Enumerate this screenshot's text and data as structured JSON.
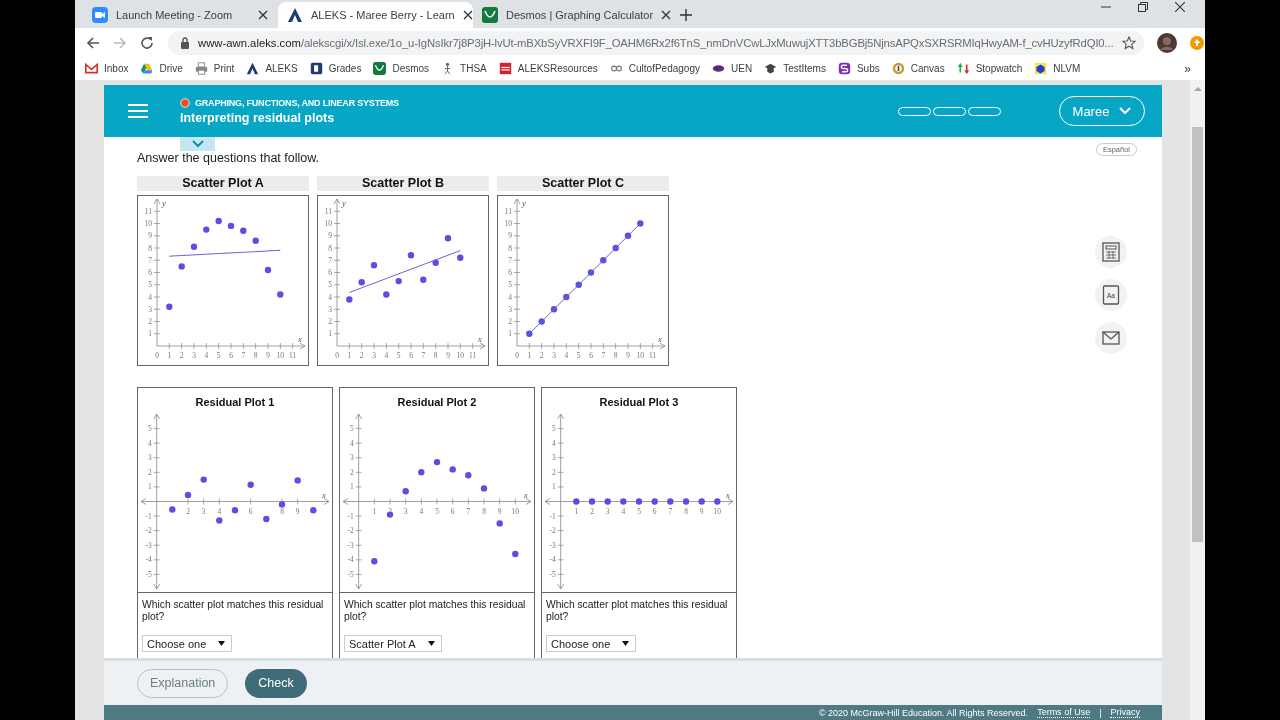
{
  "browser": {
    "tabs": [
      {
        "title": "Launch Meeting - Zoom",
        "kind": "zoom",
        "selected": false
      },
      {
        "title": "ALEKS - Maree Berry - Learn",
        "kind": "aleks",
        "selected": true
      },
      {
        "title": "Desmos | Graphing Calculator",
        "kind": "desmos",
        "selected": false
      }
    ],
    "address": {
      "host": "www-awn.aleks.com",
      "path": "/alekscgi/x/Isl.exe/1o_u-IgNsIkr7j8P3jH-lvUt-mBXbSyVRXFI9F_OAHM6Rx2f6TnS_nmDnVCwLJxMuwujXTT3bBGBj5NjnsAPQxSXRSRMIqHwyAM-f_cvHUzyfRdQI0..."
    },
    "bookmarks": [
      {
        "label": "Inbox",
        "kind": "gmail"
      },
      {
        "label": "Drive",
        "kind": "drive"
      },
      {
        "label": "Print",
        "kind": "print"
      },
      {
        "label": "ALEKS",
        "kind": "aleks"
      },
      {
        "label": "Grades",
        "kind": "grades"
      },
      {
        "label": "Desmos",
        "kind": "desmos"
      },
      {
        "label": "THSA",
        "kind": "thsa"
      },
      {
        "label": "ALEKSResources",
        "kind": "mcgraw"
      },
      {
        "label": "CultofPedagogy",
        "kind": "link"
      },
      {
        "label": "UEN",
        "kind": "uen"
      },
      {
        "label": "TestItems",
        "kind": "cap"
      },
      {
        "label": "Subs",
        "kind": "subs"
      },
      {
        "label": "Canvas",
        "kind": "canvas"
      },
      {
        "label": "Stopwatch",
        "kind": "arrows"
      },
      {
        "label": "NLVM",
        "kind": "nlvm"
      }
    ],
    "more": "»"
  },
  "header": {
    "topic": "GRAPHING, FUNCTIONS, AND LINEAR SYSTEMS",
    "title": "Interpreting residual plots",
    "progress": {
      "level": 0
    },
    "user": "Maree"
  },
  "instructions": "Answer the questions that follow.",
  "language_button": "Español",
  "tools": [
    {
      "kind": "calculator"
    },
    {
      "kind": "dictionary",
      "label": "Aa"
    },
    {
      "kind": "mail"
    }
  ],
  "scatter_plots": [
    {
      "chart_data": {
        "type": "scatter",
        "title": "Scatter Plot A",
        "xlabel": "x",
        "ylabel": "y",
        "x": [
          1,
          2,
          3,
          4,
          5,
          6,
          7,
          8,
          9,
          10
        ],
        "series": [
          {
            "color": "#5a4fe0",
            "values": [
              3.2,
              6.5,
              8.1,
              9.5,
              10.2,
              9.8,
              9.4,
              8.6,
              6.2,
              4.2
            ]
          },
          {
            "type": "line",
            "color": "#6a62d0",
            "values": [
              7.33,
              7.39,
              7.44,
              7.49,
              7.55,
              7.6,
              7.65,
              7.7,
              7.76,
              7.81
            ]
          }
        ],
        "xlim": [
          0,
          12
        ],
        "ylim": [
          0,
          12
        ],
        "xticks": [
          0,
          1,
          2,
          3,
          4,
          5,
          6,
          7,
          8,
          9,
          10,
          11
        ],
        "yticks": [
          1,
          2,
          3,
          4,
          5,
          6,
          7,
          8,
          9,
          10,
          11
        ]
      }
    },
    {
      "chart_data": {
        "type": "scatter",
        "title": "Scatter Plot B",
        "xlabel": "x",
        "ylabel": "y",
        "x": [
          1,
          2,
          3,
          4,
          5,
          6,
          7,
          8,
          9,
          10
        ],
        "series": [
          {
            "color": "#5a4fe0",
            "values": [
              3.8,
              5.2,
              6.6,
              4.2,
              5.3,
              7.4,
              5.4,
              6.8,
              8.8,
              7.2
            ]
          },
          {
            "type": "line",
            "color": "#6a62d0",
            "values": [
              4.37,
              4.75,
              5.13,
              5.51,
              5.89,
              6.27,
              6.65,
              7.03,
              7.41,
              7.79
            ]
          }
        ],
        "xlim": [
          0,
          12
        ],
        "ylim": [
          0,
          12
        ],
        "xticks": [
          0,
          1,
          2,
          3,
          4,
          5,
          6,
          7,
          8,
          9,
          10,
          11
        ],
        "yticks": [
          1,
          2,
          3,
          4,
          5,
          6,
          7,
          8,
          9,
          10,
          11
        ]
      }
    },
    {
      "chart_data": {
        "type": "scatter",
        "title": "Scatter Plot C",
        "xlabel": "x",
        "ylabel": "y",
        "x": [
          1,
          2,
          3,
          4,
          5,
          6,
          7,
          8,
          9,
          10
        ],
        "series": [
          {
            "color": "#5a4fe0",
            "values": [
              1,
              2,
              3,
              4,
              5,
              6,
              7,
              8,
              9,
              10
            ]
          },
          {
            "type": "line",
            "color": "#6a62d0",
            "values": [
              1,
              2,
              3,
              4,
              5,
              6,
              7,
              8,
              9,
              10
            ]
          }
        ],
        "xlim": [
          0,
          12
        ],
        "ylim": [
          0,
          12
        ],
        "xticks": [
          0,
          1,
          2,
          3,
          4,
          5,
          6,
          7,
          8,
          9,
          10,
          11
        ],
        "yticks": [
          1,
          2,
          3,
          4,
          5,
          6,
          7,
          8,
          9,
          10,
          11
        ]
      }
    }
  ],
  "residual_plots": [
    {
      "chart_data": {
        "type": "scatter",
        "title": "Residual Plot 1",
        "xlabel": "x",
        "x": [
          1,
          2,
          3,
          4,
          5,
          6,
          7,
          8,
          9,
          10
        ],
        "series": [
          {
            "color": "#5a4fe0",
            "values": [
              -0.55,
              0.45,
              1.5,
              -1.3,
              -0.6,
              1.15,
              -1.2,
              -0.2,
              1.45,
              -0.6
            ]
          }
        ],
        "xlim": [
          -1,
          11
        ],
        "ylim": [
          -6,
          6
        ],
        "xticks": [
          2,
          3,
          4,
          6,
          8,
          9
        ],
        "yticks": [
          -5,
          -4,
          -3,
          -2,
          -1,
          1,
          2,
          3,
          4,
          5
        ]
      },
      "question": "Which scatter plot matches this residual plot?",
      "selection": "Choose one"
    },
    {
      "chart_data": {
        "type": "scatter",
        "title": "Residual Plot 2",
        "xlabel": "x",
        "x": [
          1,
          2,
          3,
          4,
          5,
          6,
          7,
          8,
          9,
          10
        ],
        "series": [
          {
            "color": "#5a4fe0",
            "values": [
              -4.1,
              -0.9,
              0.7,
              2.0,
              2.7,
              2.2,
              1.8,
              0.9,
              -1.5,
              -3.6
            ]
          }
        ],
        "xlim": [
          -1,
          11
        ],
        "ylim": [
          -6,
          6
        ],
        "xticks": [
          1,
          2,
          3,
          4,
          5,
          6,
          7,
          8,
          9,
          10
        ],
        "yticks": [
          -5,
          -4,
          -3,
          -2,
          -1,
          1,
          2,
          3,
          4,
          5
        ]
      },
      "question": "Which scatter plot matches this residual plot?",
      "selection": "Scatter Plot A"
    },
    {
      "chart_data": {
        "type": "scatter",
        "title": "Residual Plot 3",
        "xlabel": "x",
        "x": [
          1,
          2,
          3,
          4,
          5,
          6,
          7,
          8,
          9,
          10
        ],
        "series": [
          {
            "color": "#5a4fe0",
            "values": [
              0,
              0,
              0,
              0,
              0,
              0,
              0,
              0,
              0,
              0
            ]
          }
        ],
        "xlim": [
          -1,
          11
        ],
        "ylim": [
          -6,
          6
        ],
        "xticks": [
          1,
          2,
          3,
          4,
          5,
          6,
          7,
          8,
          9,
          10
        ],
        "yticks": [
          -5,
          -4,
          -3,
          -2,
          -1,
          1,
          2,
          3,
          4,
          5
        ]
      },
      "question": "Which scatter plot matches this residual plot?",
      "selection": "Choose one"
    }
  ],
  "buttons": [
    {
      "label": "Explanation",
      "kind": "secondary"
    },
    {
      "label": "Check",
      "kind": "primary"
    }
  ],
  "footer": {
    "copyright": "© 2020 McGraw-Hill Education. All Rights Reserved.",
    "links": [
      "Terms of Use",
      "Privacy"
    ],
    "separator": "|"
  }
}
